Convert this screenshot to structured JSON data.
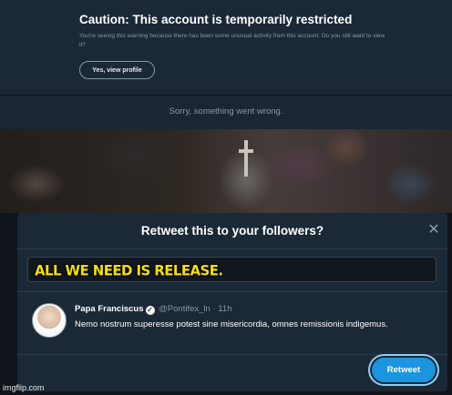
{
  "caution": {
    "title": "Caution: This account is temporarily restricted",
    "body": "You're seeing this warning because there has been some unusual activity from this account. Do you still want to view it?",
    "view_button": "Yes, view profile"
  },
  "error": {
    "message": "Sorry, something went wrong."
  },
  "modal": {
    "title": "Retweet this to your followers?",
    "close_icon": "close-icon",
    "comment_value": "ALL WE NEED IS RELEASE.",
    "tweet": {
      "author_name": "Papa Franciscus",
      "verified_icon": "verified-icon",
      "handle": "@Pontifex_ln",
      "separator": "·",
      "time": "11h",
      "text": "Nemo nostrum superesse potest sine misericordia, omnes remissionis indigemus."
    },
    "retweet_button": "Retweet",
    "accent_color": "#1b95e0"
  },
  "watermark": "imgflip.com"
}
